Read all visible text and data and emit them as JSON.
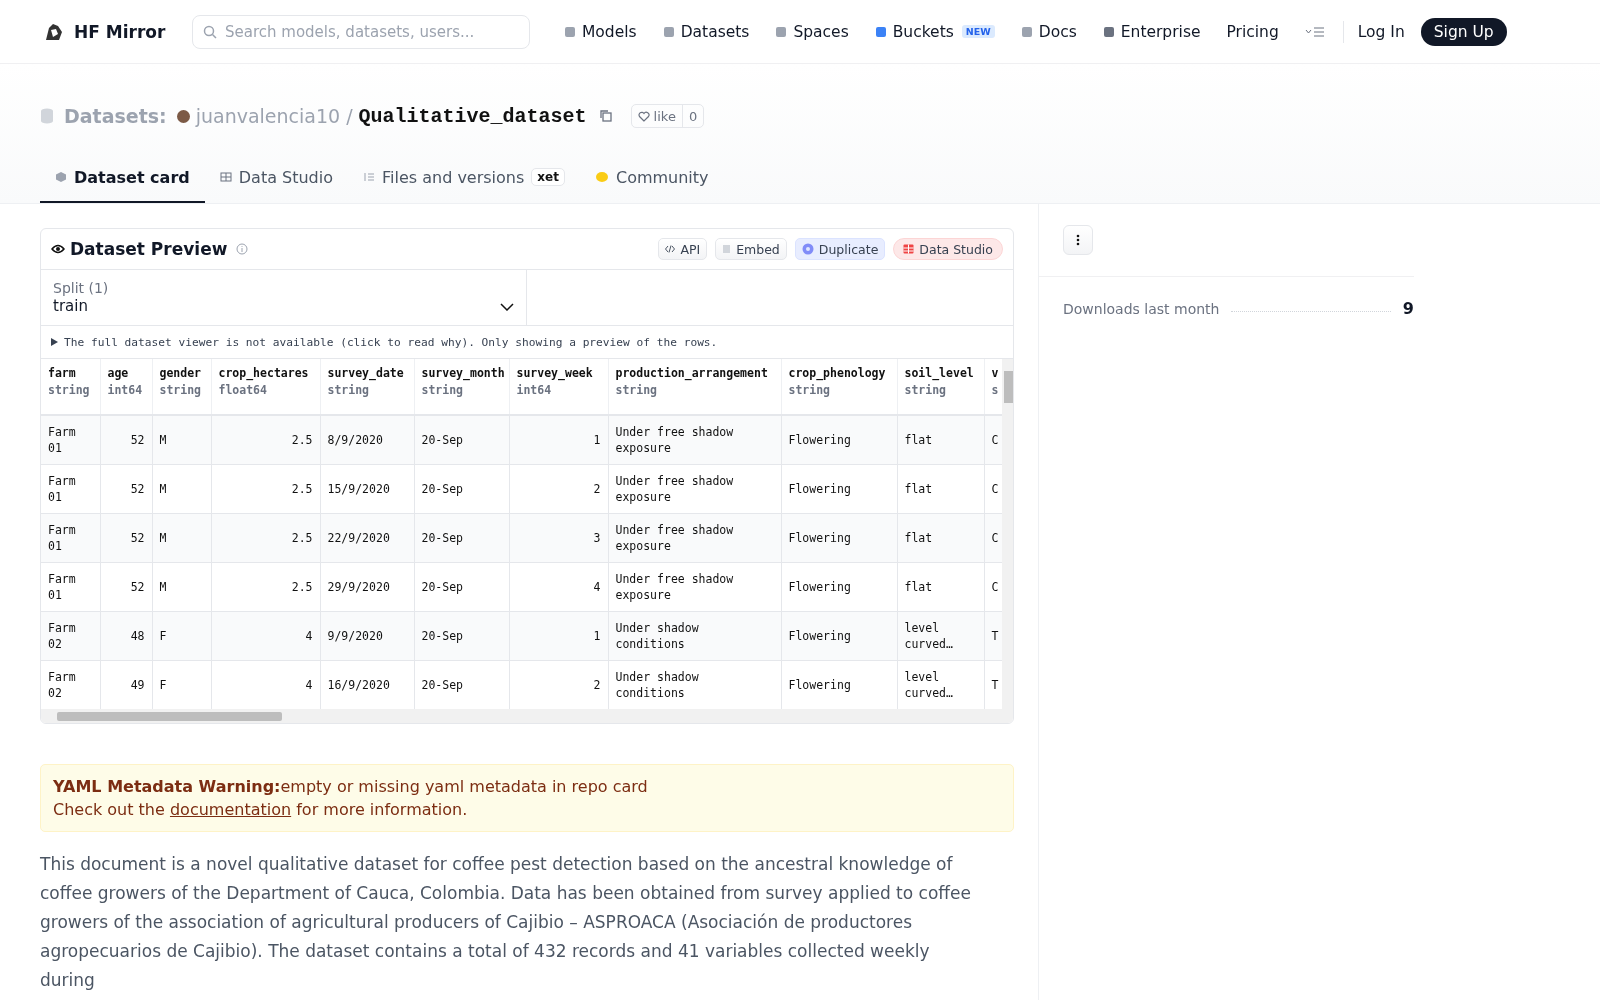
{
  "header": {
    "brand": "HF Mirror",
    "search": {
      "placeholder": "Search models, datasets, users..."
    },
    "nav": [
      {
        "label": "Models",
        "kind": "models"
      },
      {
        "label": "Datasets",
        "kind": "datasets"
      },
      {
        "label": "Spaces",
        "kind": "spaces"
      },
      {
        "label": "Buckets",
        "kind": "buckets",
        "badge": "NEW"
      },
      {
        "label": "Docs",
        "kind": "docs"
      },
      {
        "label": "Enterprise",
        "kind": "enterprise"
      },
      {
        "label": "Pricing",
        "kind": "plain"
      }
    ],
    "login": "Log In",
    "signup": "Sign Up"
  },
  "repo": {
    "type_label": "Datasets:",
    "owner": "juanvalencia10",
    "separator": "/",
    "name": "Qualitative_dataset",
    "like_label": "like",
    "like_count": "0"
  },
  "tabs": [
    {
      "label": "Dataset card",
      "kind": "card",
      "selected": true
    },
    {
      "label": "Data Studio",
      "kind": "studio",
      "selected": false
    },
    {
      "label": "Files and versions",
      "kind": "files",
      "selected": false,
      "badge": "xet"
    },
    {
      "label": "Community",
      "kind": "community",
      "selected": false
    }
  ],
  "preview": {
    "title": "Dataset Preview",
    "actions": [
      {
        "label": "API",
        "kind": "api"
      },
      {
        "label": "Embed",
        "kind": "embed"
      },
      {
        "label": "Duplicate",
        "kind": "duplicate"
      },
      {
        "label": "Data Studio",
        "kind": "studio"
      }
    ],
    "split_label": "Split (1)",
    "split_value": "train",
    "notice": "The full dataset viewer is not available (click to read why). Only showing a preview of the rows.",
    "columns": [
      {
        "name": "farm",
        "type": "string"
      },
      {
        "name": "age",
        "type": "int64"
      },
      {
        "name": "gender",
        "type": "string"
      },
      {
        "name": "crop_hectares",
        "type": "float64"
      },
      {
        "name": "survey_date",
        "type": "string"
      },
      {
        "name": "survey_month",
        "type": "string"
      },
      {
        "name": "survey_week",
        "type": "int64"
      },
      {
        "name": "production_arrangement",
        "type": "string"
      },
      {
        "name": "crop_phenology",
        "type": "string"
      },
      {
        "name": "soil_level",
        "type": "string"
      },
      {
        "name": "v",
        "type": "s"
      }
    ],
    "rows": [
      [
        "Farm 01",
        "52",
        "M",
        "2.5",
        "8/9/2020",
        "20-Sep",
        "1",
        "Under free shadow exposure",
        "Flowering",
        "flat",
        "C"
      ],
      [
        "Farm 01",
        "52",
        "M",
        "2.5",
        "15/9/2020",
        "20-Sep",
        "2",
        "Under free shadow exposure",
        "Flowering",
        "flat",
        "C"
      ],
      [
        "Farm 01",
        "52",
        "M",
        "2.5",
        "22/9/2020",
        "20-Sep",
        "3",
        "Under free shadow exposure",
        "Flowering",
        "flat",
        "C"
      ],
      [
        "Farm 01",
        "52",
        "M",
        "2.5",
        "29/9/2020",
        "20-Sep",
        "4",
        "Under free shadow exposure",
        "Flowering",
        "flat",
        "C"
      ],
      [
        "Farm 02",
        "48",
        "F",
        "4",
        "9/9/2020",
        "20-Sep",
        "1",
        "Under shadow conditions",
        "Flowering",
        "level curved…",
        "T"
      ],
      [
        "Farm 02",
        "49",
        "F",
        "4",
        "16/9/2020",
        "20-Sep",
        "2",
        "Under shadow conditions",
        "Flowering",
        "level curved…",
        "T"
      ]
    ]
  },
  "warning": {
    "title": "YAML Metadata Warning:",
    "message": "empty or missing yaml metadata in repo card",
    "prefix": "Check out the",
    "link": "documentation",
    "suffix": "for more information."
  },
  "description": "This document is a novel qualitative dataset for coffee pest detection based on the ancestral knowledge of coffee growers of the Department of Cauca, Colombia. Data has been obtained from survey applied to coffee growers of the association of agricultural producers of Cajibio – ASPROACA (Asociación de productores agropecuarios de Cajibio). The dataset contains a total of 432 records and 41 variables collected weekly during",
  "sidebar": {
    "downloads_label": "Downloads last month",
    "downloads_value": "9"
  }
}
